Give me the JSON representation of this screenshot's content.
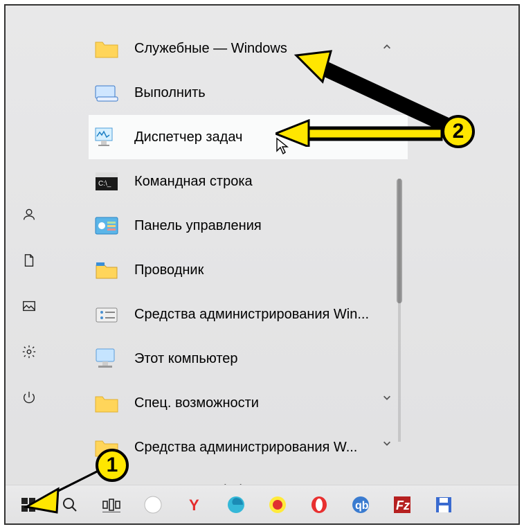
{
  "folder_header": "Служебные — Windows",
  "items": [
    {
      "label": "Выполнить"
    },
    {
      "label": "Диспетчер задач"
    },
    {
      "label": "Командная строка"
    },
    {
      "label": "Панель управления"
    },
    {
      "label": "Проводник"
    },
    {
      "label": "Средства администрирования Win..."
    },
    {
      "label": "Этот компьютер"
    }
  ],
  "folder_spec": "Спец. возможности",
  "folder_admin": "Средства администрирования W...",
  "folder_cut": "дартные — Windows",
  "callout_1": "1",
  "callout_2": "2"
}
